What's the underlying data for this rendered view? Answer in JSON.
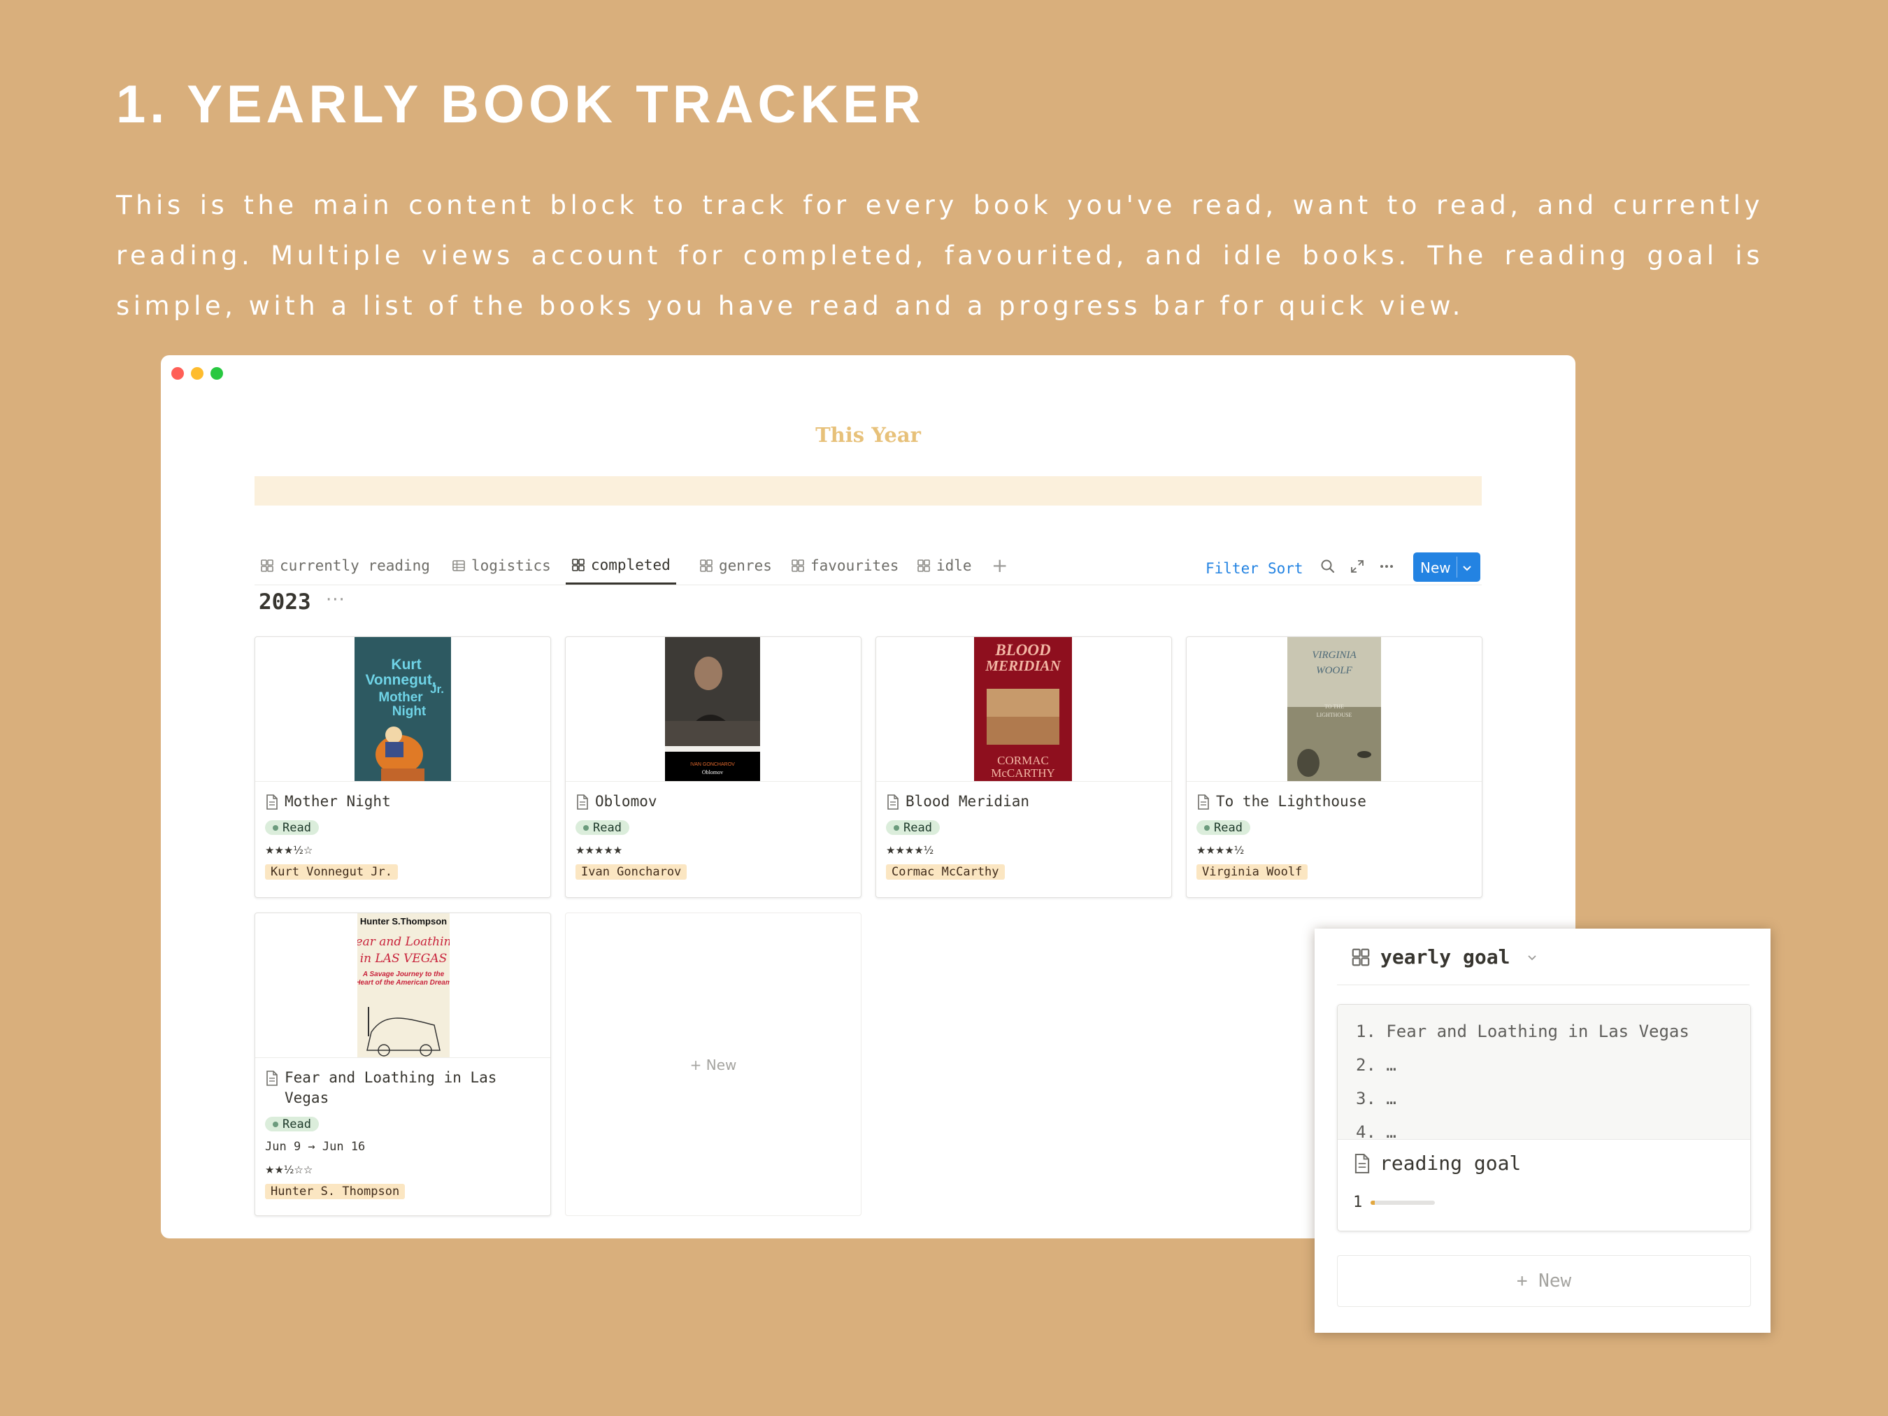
{
  "heading": "1. YEARLY BOOK TRACKER",
  "description": "This is the main content block to track for every book you've read, want to read, and currently reading. Multiple views account for completed, favourited, and idle books. The reading goal is simple, with a list of the books you have read and a progress bar for quick view.",
  "window": {
    "page_title": "This Year",
    "tabs": [
      {
        "label": "currently reading",
        "icon": "gallery-icon"
      },
      {
        "label": "logistics",
        "icon": "table-icon"
      },
      {
        "label": "completed",
        "icon": "gallery-icon",
        "active": true
      },
      {
        "label": "genres",
        "icon": "gallery-icon"
      },
      {
        "label": "favourites",
        "icon": "gallery-icon"
      },
      {
        "label": "idle",
        "icon": "gallery-icon"
      }
    ],
    "toolbar": {
      "filter": "Filter",
      "sort": "Sort",
      "new": "New"
    },
    "group": {
      "title": "2023",
      "more": "···"
    },
    "cards": [
      {
        "title": "Mother Night",
        "status": "Read",
        "rating": "★★★½☆",
        "author": "Kurt Vonnegut Jr."
      },
      {
        "title": "Oblomov",
        "status": "Read",
        "rating": "★★★★★",
        "author": "Ivan Goncharov"
      },
      {
        "title": "Blood Meridian",
        "status": "Read",
        "rating": "★★★★½",
        "author": "Cormac McCarthy"
      },
      {
        "title": "To the Lighthouse",
        "status": "Read",
        "rating": "★★★★½",
        "author": "Virginia Woolf"
      },
      {
        "title": "Fear and Loathing in Las Vegas",
        "status": "Read",
        "dates": "Jun 9 → Jun 16",
        "rating": "★★½☆☆",
        "author": "Hunter S. Thompson"
      }
    ],
    "covers": {
      "mother_night": [
        "Kurt",
        "Vonnegut,",
        "Jr.",
        "Mother",
        "Night"
      ],
      "oblomov": [
        "IVAN GONCHAROV",
        "Oblomov"
      ],
      "blood_meridian": [
        "BLOOD",
        "MERIDIAN",
        "CORMAC",
        "McCARTHY"
      ],
      "lighthouse": [
        "VIRGINIA",
        "WOOLF",
        "TO THE",
        "LIGHTHOUSE"
      ],
      "fear_loathing": [
        "Hunter S.Thompson",
        "Fear and Loathing",
        "in LAS VEGAS",
        "A Savage Journey to the",
        "Heart of the American Dream"
      ]
    },
    "new_card": "+ New"
  },
  "goal": {
    "title": "yearly goal",
    "list": [
      "1. Fear and Loathing in Las Vegas",
      "2. …",
      "3. …",
      "4. …"
    ],
    "sub_title": "reading goal",
    "progress_value": "1",
    "progress_fraction": 0.02,
    "progress_color": "#E2A73E",
    "new": "+ New"
  }
}
